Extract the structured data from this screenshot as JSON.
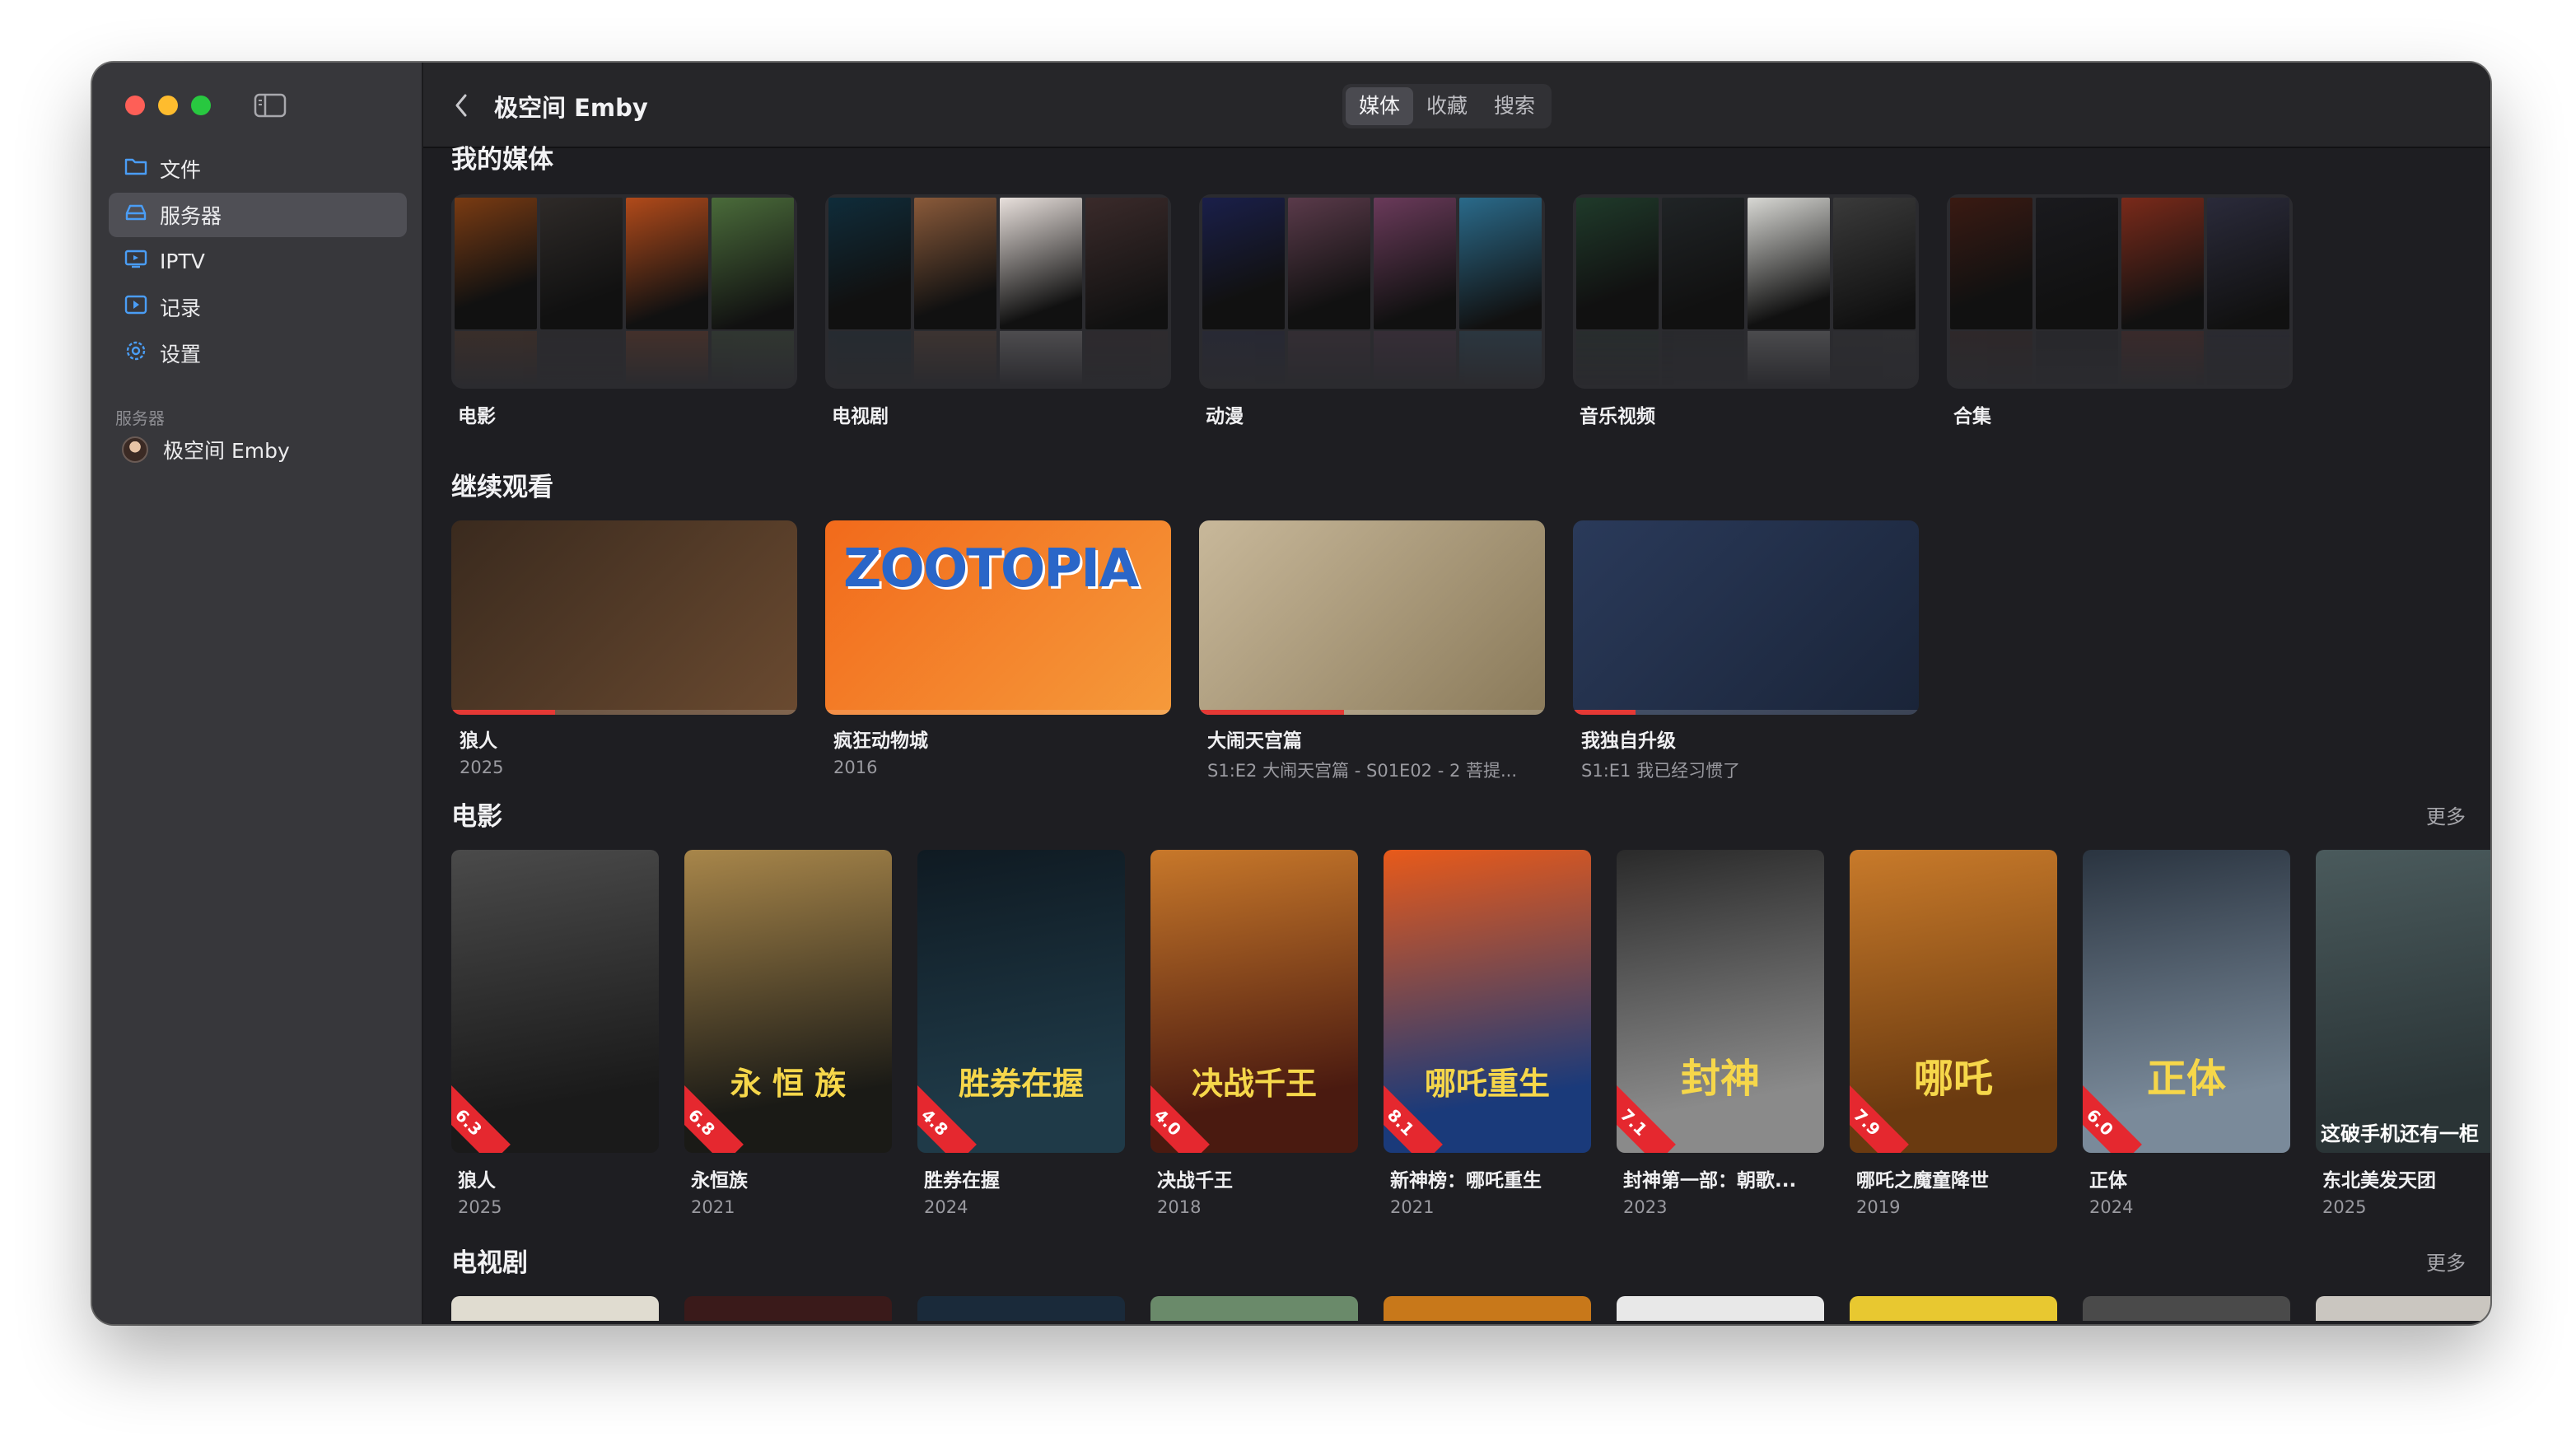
{
  "window": {
    "title": "极空间 Emby"
  },
  "sidebar": {
    "items": [
      {
        "label": "文件",
        "icon": "folder-icon"
      },
      {
        "label": "服务器",
        "icon": "server-icon",
        "active": true
      },
      {
        "label": "IPTV",
        "icon": "tv-icon"
      },
      {
        "label": "记录",
        "icon": "play-record-icon"
      },
      {
        "label": "设置",
        "icon": "gear-icon"
      }
    ],
    "section_label": "服务器",
    "server_name": "极空间 Emby"
  },
  "toolbar": {
    "title": "极空间 Emby",
    "tabs": [
      "媒体",
      "收藏",
      "搜索"
    ],
    "active_tab": "媒体"
  },
  "sections": {
    "my_media": {
      "title": "我的媒体",
      "libraries": [
        {
          "label": "电影",
          "colors": [
            "#7a3b12",
            "#2e2a28",
            "#b14a1a",
            "#4a6b3a"
          ]
        },
        {
          "label": "电视剧",
          "colors": [
            "#0f2c3a",
            "#8a5a3a",
            "#e8e0dc",
            "#3a2a2a"
          ]
        },
        {
          "label": "动漫",
          "colors": [
            "#1a1f4a",
            "#5a3a4a",
            "#6a3a5a",
            "#2a6a8a"
          ]
        },
        {
          "label": "音乐视频",
          "colors": [
            "#1f3a2a",
            "#202426",
            "#d8d8d4",
            "#3a3a3a"
          ]
        },
        {
          "label": "合集",
          "colors": [
            "#3a1a12",
            "#1a1a1e",
            "#7a2a1a",
            "#2a2a3a"
          ]
        }
      ]
    },
    "continue_watching": {
      "title": "继续观看",
      "items": [
        {
          "title": "狼人",
          "subtitle": "2025",
          "progress": 0.3,
          "colors": [
            "#3a2a1e",
            "#6a4a30"
          ]
        },
        {
          "title": "疯狂动物城",
          "subtitle": "2016",
          "progress": 0.0,
          "logo_text": "ZOOTOPIA",
          "colors": [
            "#f26a1b",
            "#f59a3b"
          ]
        },
        {
          "title": "大闹天宫篇",
          "subtitle": "S1:E2 大闹天宫篇 - S01E02 - 2 菩提...",
          "progress": 0.42,
          "colors": [
            "#c8b89a",
            "#8a7a5a"
          ]
        },
        {
          "title": "我独自升级",
          "subtitle": "S1:E1 我已经习惯了",
          "progress": 0.18,
          "colors": [
            "#2a3a5a",
            "#1a2438"
          ]
        }
      ]
    },
    "movies": {
      "title": "电影",
      "more": "更多",
      "items": [
        {
          "title": "狼人",
          "year": "2025",
          "rating": "6.3",
          "colors": [
            "#1a1a1a",
            "#4a4a4a"
          ]
        },
        {
          "title": "永恒族",
          "year": "2021",
          "rating": "6.8",
          "poster_text": "永 恒 族",
          "colors": [
            "#1a1a16",
            "#a8864a"
          ]
        },
        {
          "title": "胜券在握",
          "year": "2024",
          "rating": "4.8",
          "poster_text": "胜券在握",
          "colors": [
            "#1f3a48",
            "#0f1a22"
          ]
        },
        {
          "title": "决战千王",
          "year": "2018",
          "rating": "4.0",
          "poster_text": "决战千王",
          "colors": [
            "#4a1a10",
            "#c8782a"
          ]
        },
        {
          "title": "新神榜：哪吒重生",
          "year": "2021",
          "rating": "8.1",
          "poster_text": "哪吒重生",
          "colors": [
            "#1a3a7a",
            "#e85a1a"
          ]
        },
        {
          "title": "封神第一部：朝歌...",
          "year": "2023",
          "rating": "7.1",
          "poster_text": "封神",
          "colors": [
            "#8a8a8a",
            "#2a2a2a"
          ]
        },
        {
          "title": "哪吒之魔童降世",
          "year": "2019",
          "rating": "7.9",
          "poster_text": "哪吒",
          "colors": [
            "#6a3a10",
            "#c87a2a"
          ]
        },
        {
          "title": "正体",
          "year": "2024",
          "rating": "6.0",
          "poster_text": "正体",
          "colors": [
            "#7a8a9a",
            "#2a3440"
          ]
        },
        {
          "title": "东北美发天团",
          "year": "2025",
          "poster_text": "这破手机还有一柜",
          "colors": [
            "#2a3436",
            "#4a5a5c"
          ]
        }
      ]
    },
    "tv": {
      "title": "电视剧",
      "more": "更多",
      "peek_colors": [
        "#e0dcd0",
        "#3a1a1a",
        "#1a2a3a",
        "#6a8a6a",
        "#c8781a",
        "#e8e8e8",
        "#e8c830",
        "#4a4a4a",
        "#cac6c0"
      ]
    }
  }
}
